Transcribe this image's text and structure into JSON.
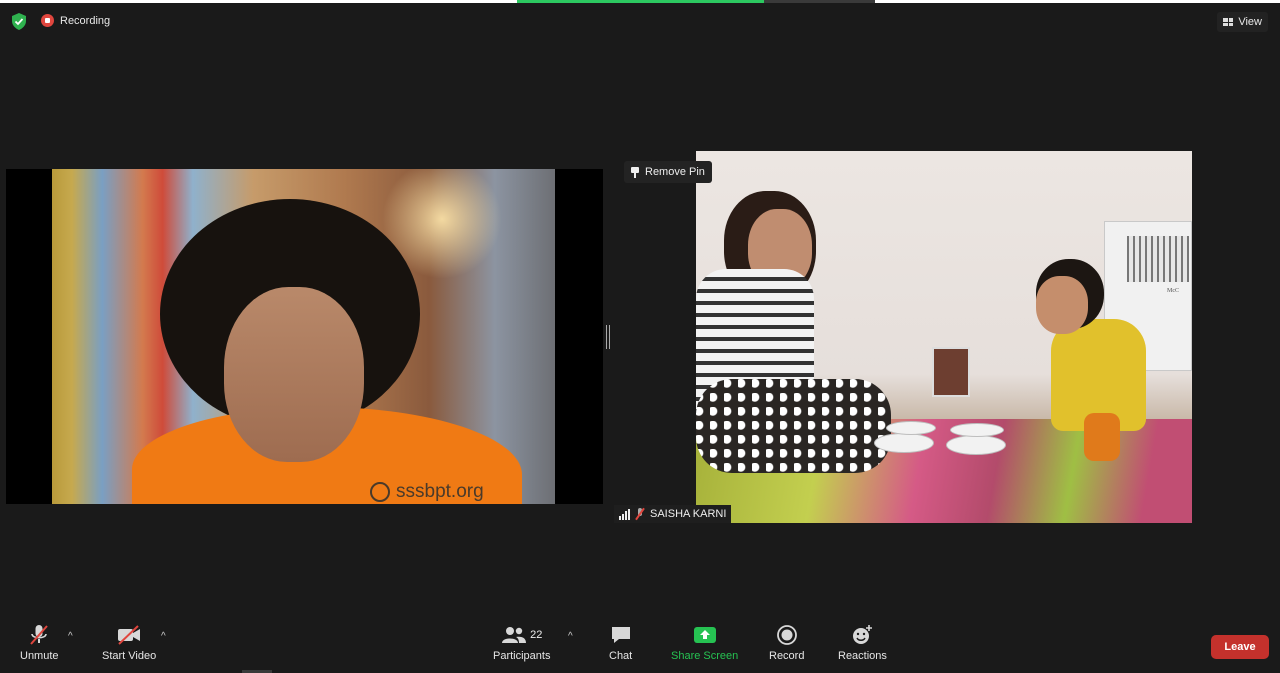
{
  "meeting": {
    "recording_label": "Recording",
    "view_label": "View",
    "share_progress": 0.69
  },
  "tiles": {
    "left": {
      "watermark": "sssbpt.org"
    },
    "right": {
      "remove_pin_label": "Remove Pin",
      "participant_name": "SAISHA KARNI",
      "cooler_brand": "McC"
    }
  },
  "toolbar": {
    "unmute_label": "Unmute",
    "start_video_label": "Start Video",
    "participants_label": "Participants",
    "participants_count": "22",
    "chat_label": "Chat",
    "share_screen_label": "Share Screen",
    "record_label": "Record",
    "reactions_label": "Reactions",
    "leave_label": "Leave"
  },
  "colors": {
    "background": "#1a1a1a",
    "share_green": "#26c252",
    "leave_red": "#c4312c",
    "recording_red": "#e0463e",
    "progress_green": "#2cc860"
  },
  "icons": {
    "security": "shield-icon",
    "recording": "recording-icon",
    "view": "view-grid-icon",
    "pin": "pin-icon",
    "signal": "signal-bars-icon",
    "muted_small": "mic-muted-icon",
    "unmute": "mic-muted-icon",
    "video": "video-off-icon",
    "participants": "participants-icon",
    "chat": "chat-icon",
    "share": "share-screen-icon",
    "record": "record-icon",
    "reactions": "reactions-icon"
  }
}
